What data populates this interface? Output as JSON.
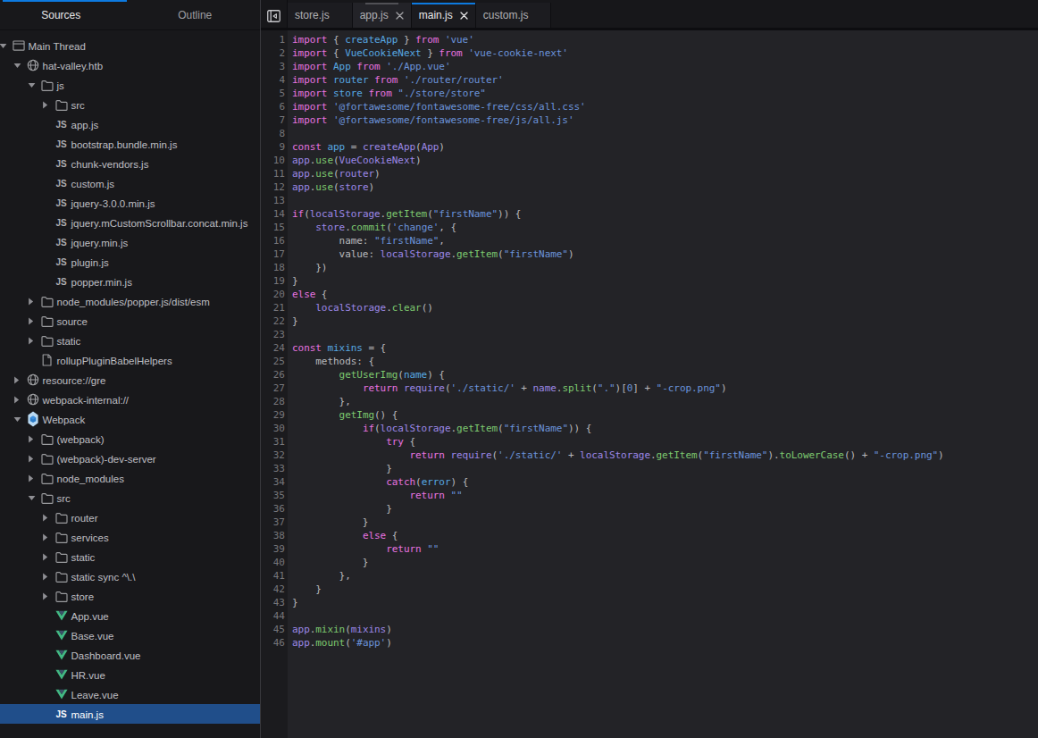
{
  "sidebar": {
    "tabs": [
      {
        "label": "Sources",
        "active": true
      },
      {
        "label": "Outline",
        "active": false
      }
    ],
    "tree": [
      {
        "label": "Main Thread",
        "level": 0,
        "icon": "window",
        "arrow": "open"
      },
      {
        "label": "hat-valley.htb",
        "level": 1,
        "icon": "globe",
        "arrow": "open"
      },
      {
        "label": "js",
        "level": 2,
        "icon": "folder",
        "arrow": "open"
      },
      {
        "label": "src",
        "level": 3,
        "icon": "folder",
        "arrow": "closed"
      },
      {
        "label": "app.js",
        "level": 3,
        "icon": "js",
        "arrow": "none"
      },
      {
        "label": "bootstrap.bundle.min.js",
        "level": 3,
        "icon": "js",
        "arrow": "none"
      },
      {
        "label": "chunk-vendors.js",
        "level": 3,
        "icon": "js",
        "arrow": "none"
      },
      {
        "label": "custom.js",
        "level": 3,
        "icon": "js",
        "arrow": "none"
      },
      {
        "label": "jquery-3.0.0.min.js",
        "level": 3,
        "icon": "js",
        "arrow": "none"
      },
      {
        "label": "jquery.mCustomScrollbar.concat.min.js",
        "level": 3,
        "icon": "js",
        "arrow": "none"
      },
      {
        "label": "jquery.min.js",
        "level": 3,
        "icon": "js",
        "arrow": "none"
      },
      {
        "label": "plugin.js",
        "level": 3,
        "icon": "js",
        "arrow": "none"
      },
      {
        "label": "popper.min.js",
        "level": 3,
        "icon": "js",
        "arrow": "none"
      },
      {
        "label": "node_modules/popper.js/dist/esm",
        "level": 2,
        "icon": "folder",
        "arrow": "closed"
      },
      {
        "label": "source",
        "level": 2,
        "icon": "folder",
        "arrow": "closed"
      },
      {
        "label": "static",
        "level": 2,
        "icon": "folder",
        "arrow": "closed"
      },
      {
        "label": "rollupPluginBabelHelpers",
        "level": 2,
        "icon": "file",
        "arrow": "none"
      },
      {
        "label": "resource://gre",
        "level": 1,
        "icon": "globe",
        "arrow": "closed"
      },
      {
        "label": "webpack-internal://",
        "level": 1,
        "icon": "globe",
        "arrow": "closed"
      },
      {
        "label": "Webpack",
        "level": 1,
        "icon": "webpack",
        "arrow": "open"
      },
      {
        "label": "(webpack)",
        "level": 2,
        "icon": "folder",
        "arrow": "closed"
      },
      {
        "label": "(webpack)-dev-server",
        "level": 2,
        "icon": "folder",
        "arrow": "closed"
      },
      {
        "label": "node_modules",
        "level": 2,
        "icon": "folder",
        "arrow": "closed"
      },
      {
        "label": "src",
        "level": 2,
        "icon": "folder",
        "arrow": "open"
      },
      {
        "label": "router",
        "level": 3,
        "icon": "folder",
        "arrow": "closed"
      },
      {
        "label": "services",
        "level": 3,
        "icon": "folder",
        "arrow": "closed"
      },
      {
        "label": "static",
        "level": 3,
        "icon": "folder",
        "arrow": "closed"
      },
      {
        "label": "static sync ^\\.\\",
        "level": 3,
        "icon": "folder",
        "arrow": "closed"
      },
      {
        "label": "store",
        "level": 3,
        "icon": "folder",
        "arrow": "closed"
      },
      {
        "label": "App.vue",
        "level": 3,
        "icon": "vue",
        "arrow": "none"
      },
      {
        "label": "Base.vue",
        "level": 3,
        "icon": "vue",
        "arrow": "none"
      },
      {
        "label": "Dashboard.vue",
        "level": 3,
        "icon": "vue",
        "arrow": "none"
      },
      {
        "label": "HR.vue",
        "level": 3,
        "icon": "vue",
        "arrow": "none"
      },
      {
        "label": "Leave.vue",
        "level": 3,
        "icon": "vue",
        "arrow": "none"
      },
      {
        "label": "main.js",
        "level": 3,
        "icon": "js",
        "arrow": "none",
        "selected": true
      }
    ]
  },
  "editor": {
    "collapse_button_icon": "collapse-panes-icon",
    "tabs": [
      {
        "label": "store.js",
        "state": "normal",
        "closable": false
      },
      {
        "label": "app.js",
        "state": "hover",
        "closable": true
      },
      {
        "label": "main.js",
        "state": "active",
        "closable": true
      },
      {
        "label": "custom.js",
        "state": "normal",
        "closable": false
      }
    ],
    "code": {
      "lines": [
        [
          [
            "k",
            "import"
          ],
          [
            "o",
            " { "
          ],
          [
            "d",
            "createApp"
          ],
          [
            "o",
            " } "
          ],
          [
            "k",
            "from"
          ],
          [
            "o",
            " "
          ],
          [
            "s",
            "'vue'"
          ]
        ],
        [
          [
            "k",
            "import"
          ],
          [
            "o",
            " { "
          ],
          [
            "d",
            "VueCookieNext"
          ],
          [
            "o",
            " } "
          ],
          [
            "k",
            "from"
          ],
          [
            "o",
            " "
          ],
          [
            "s",
            "'vue-cookie-next'"
          ]
        ],
        [
          [
            "k",
            "import"
          ],
          [
            "o",
            " "
          ],
          [
            "d",
            "App"
          ],
          [
            "o",
            " "
          ],
          [
            "k",
            "from"
          ],
          [
            "o",
            " "
          ],
          [
            "s",
            "'./App.vue'"
          ]
        ],
        [
          [
            "k",
            "import"
          ],
          [
            "o",
            " "
          ],
          [
            "d",
            "router"
          ],
          [
            "o",
            " "
          ],
          [
            "k",
            "from"
          ],
          [
            "o",
            " "
          ],
          [
            "s",
            "'./router/router'"
          ]
        ],
        [
          [
            "k",
            "import"
          ],
          [
            "o",
            " "
          ],
          [
            "d",
            "store"
          ],
          [
            "o",
            " "
          ],
          [
            "k",
            "from"
          ],
          [
            "o",
            " "
          ],
          [
            "s",
            "\"./store/store\""
          ]
        ],
        [
          [
            "k",
            "import"
          ],
          [
            "o",
            " "
          ],
          [
            "s",
            "'@fortawesome/fontawesome-free/css/all.css'"
          ]
        ],
        [
          [
            "k",
            "import"
          ],
          [
            "o",
            " "
          ],
          [
            "s",
            "'@fortawesome/fontawesome-free/js/all.js'"
          ]
        ],
        [],
        [
          [
            "k",
            "const"
          ],
          [
            "o",
            " "
          ],
          [
            "d",
            "app"
          ],
          [
            "o",
            " = "
          ],
          [
            "v",
            "createApp"
          ],
          [
            "o",
            "("
          ],
          [
            "v",
            "App"
          ],
          [
            "o",
            ")"
          ]
        ],
        [
          [
            "v",
            "app"
          ],
          [
            "o",
            "."
          ],
          [
            "p",
            "use"
          ],
          [
            "o",
            "("
          ],
          [
            "v",
            "VueCookieNext"
          ],
          [
            "o",
            ")"
          ]
        ],
        [
          [
            "v",
            "app"
          ],
          [
            "o",
            "."
          ],
          [
            "p",
            "use"
          ],
          [
            "o",
            "("
          ],
          [
            "v",
            "router"
          ],
          [
            "o",
            ")"
          ]
        ],
        [
          [
            "v",
            "app"
          ],
          [
            "o",
            "."
          ],
          [
            "p",
            "use"
          ],
          [
            "o",
            "("
          ],
          [
            "v",
            "store"
          ],
          [
            "o",
            ")"
          ]
        ],
        [],
        [
          [
            "k",
            "if"
          ],
          [
            "o",
            "("
          ],
          [
            "v",
            "localStorage"
          ],
          [
            "o",
            "."
          ],
          [
            "p",
            "getItem"
          ],
          [
            "o",
            "("
          ],
          [
            "s",
            "\"firstName\""
          ],
          [
            "o",
            ")) {"
          ]
        ],
        [
          [
            "o",
            "    "
          ],
          [
            "v",
            "store"
          ],
          [
            "o",
            "."
          ],
          [
            "p",
            "commit"
          ],
          [
            "o",
            "("
          ],
          [
            "s",
            "'change'"
          ],
          [
            "o",
            ", {"
          ]
        ],
        [
          [
            "o",
            "        name: "
          ],
          [
            "s",
            "\"firstName\""
          ],
          [
            "o",
            ","
          ]
        ],
        [
          [
            "o",
            "        value: "
          ],
          [
            "v",
            "localStorage"
          ],
          [
            "o",
            "."
          ],
          [
            "p",
            "getItem"
          ],
          [
            "o",
            "("
          ],
          [
            "s",
            "\"firstName\""
          ],
          [
            "o",
            ")"
          ]
        ],
        [
          [
            "o",
            "    })"
          ]
        ],
        [
          [
            "o",
            "}"
          ]
        ],
        [
          [
            "k",
            "else"
          ],
          [
            "o",
            " {"
          ]
        ],
        [
          [
            "o",
            "    "
          ],
          [
            "v",
            "localStorage"
          ],
          [
            "o",
            "."
          ],
          [
            "p",
            "clear"
          ],
          [
            "o",
            "()"
          ]
        ],
        [
          [
            "o",
            "}"
          ]
        ],
        [],
        [
          [
            "k",
            "const"
          ],
          [
            "o",
            " "
          ],
          [
            "d",
            "mixins"
          ],
          [
            "o",
            " = {"
          ]
        ],
        [
          [
            "o",
            "    methods: {"
          ]
        ],
        [
          [
            "o",
            "        "
          ],
          [
            "p",
            "getUserImg"
          ],
          [
            "o",
            "("
          ],
          [
            "d",
            "name"
          ],
          [
            "o",
            ") {"
          ]
        ],
        [
          [
            "o",
            "            "
          ],
          [
            "k",
            "return"
          ],
          [
            "o",
            " "
          ],
          [
            "v",
            "require"
          ],
          [
            "o",
            "("
          ],
          [
            "s",
            "'./static/'"
          ],
          [
            "o",
            " + "
          ],
          [
            "v",
            "name"
          ],
          [
            "o",
            "."
          ],
          [
            "p",
            "split"
          ],
          [
            "o",
            "("
          ],
          [
            "s",
            "\".\""
          ],
          [
            "o",
            ")["
          ],
          [
            "n",
            "0"
          ],
          [
            "o",
            "] + "
          ],
          [
            "s",
            "\"-crop.png\""
          ],
          [
            "o",
            ")"
          ]
        ],
        [
          [
            "o",
            "        },"
          ]
        ],
        [
          [
            "o",
            "        "
          ],
          [
            "p",
            "getImg"
          ],
          [
            "o",
            "() {"
          ]
        ],
        [
          [
            "o",
            "            "
          ],
          [
            "k",
            "if"
          ],
          [
            "o",
            "("
          ],
          [
            "v",
            "localStorage"
          ],
          [
            "o",
            "."
          ],
          [
            "p",
            "getItem"
          ],
          [
            "o",
            "("
          ],
          [
            "s",
            "\"firstName\""
          ],
          [
            "o",
            ")) {"
          ]
        ],
        [
          [
            "o",
            "                "
          ],
          [
            "k",
            "try"
          ],
          [
            "o",
            " {"
          ]
        ],
        [
          [
            "o",
            "                    "
          ],
          [
            "k",
            "return"
          ],
          [
            "o",
            " "
          ],
          [
            "v",
            "require"
          ],
          [
            "o",
            "("
          ],
          [
            "s",
            "'./static/'"
          ],
          [
            "o",
            " + "
          ],
          [
            "v",
            "localStorage"
          ],
          [
            "o",
            "."
          ],
          [
            "p",
            "getItem"
          ],
          [
            "o",
            "("
          ],
          [
            "s",
            "\"firstName\""
          ],
          [
            "o",
            ")."
          ],
          [
            "p",
            "toLowerCase"
          ],
          [
            "o",
            "() + "
          ],
          [
            "s",
            "\"-crop.png\""
          ],
          [
            "o",
            ")"
          ]
        ],
        [
          [
            "o",
            "                }"
          ]
        ],
        [
          [
            "o",
            "                "
          ],
          [
            "k",
            "catch"
          ],
          [
            "o",
            "("
          ],
          [
            "d",
            "error"
          ],
          [
            "o",
            ") {"
          ]
        ],
        [
          [
            "o",
            "                    "
          ],
          [
            "k",
            "return"
          ],
          [
            "o",
            " "
          ],
          [
            "s",
            "\"\""
          ]
        ],
        [
          [
            "o",
            "                }"
          ]
        ],
        [
          [
            "o",
            "            }"
          ]
        ],
        [
          [
            "o",
            "            "
          ],
          [
            "k",
            "else"
          ],
          [
            "o",
            " {"
          ]
        ],
        [
          [
            "o",
            "                "
          ],
          [
            "k",
            "return"
          ],
          [
            "o",
            " "
          ],
          [
            "s",
            "\"\""
          ]
        ],
        [
          [
            "o",
            "            }"
          ]
        ],
        [
          [
            "o",
            "        },"
          ]
        ],
        [
          [
            "o",
            "    }"
          ]
        ],
        [
          [
            "o",
            "}"
          ]
        ],
        [],
        [
          [
            "v",
            "app"
          ],
          [
            "o",
            "."
          ],
          [
            "p",
            "mixin"
          ],
          [
            "o",
            "("
          ],
          [
            "v",
            "mixins"
          ],
          [
            "o",
            ")"
          ]
        ],
        [
          [
            "v",
            "app"
          ],
          [
            "o",
            "."
          ],
          [
            "p",
            "mount"
          ],
          [
            "o",
            "("
          ],
          [
            "s",
            "'#app'"
          ],
          [
            "o",
            ")"
          ]
        ]
      ]
    }
  },
  "colors": {
    "accent_blue": "#0D7AE0",
    "selection_blue": "#204E8A",
    "keyword": "#E873E0",
    "variable": "#9C88E8",
    "definition": "#57A8E2",
    "property": "#7DC96F",
    "string": "#6B93DB"
  }
}
